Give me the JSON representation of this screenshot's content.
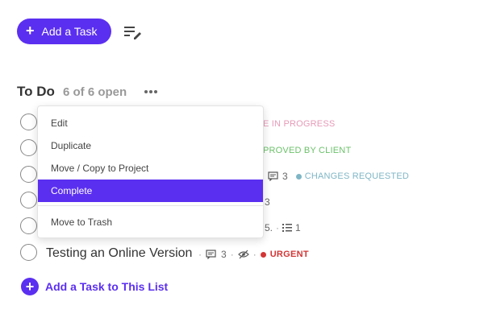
{
  "toolbar": {
    "add_task_label": "Add a Task"
  },
  "list": {
    "title": "To Do",
    "count": "6 of 6 open"
  },
  "menu": {
    "items": [
      "Edit",
      "Duplicate",
      "Move / Copy to Project",
      "Complete",
      "Move to Trash"
    ],
    "active": "Complete"
  },
  "rows": {
    "row1_status": "E IN PROGRESS",
    "row2_status": "PROVED BY CLIENT",
    "row3_comments": "3",
    "row3_status": "CHANGES REQUESTED",
    "row4_comments": "3",
    "row5_text": "5.",
    "row5_subtasks": "1",
    "row6_title": "Testing an Online Version",
    "row6_comments": "3",
    "row6_status": "URGENT"
  },
  "footer": {
    "add_task_list_label": "Add a Task to This List"
  },
  "colors": {
    "accent": "#5b2ff0",
    "in_progress": "#e69ab7",
    "approved": "#6cc16a",
    "changes_requested": "#7fb6c6",
    "urgent": "#d33636"
  },
  "icons": [
    "plus-icon",
    "edit-list-icon",
    "more-icon",
    "comment-icon",
    "subtask-icon",
    "hidden-eye-icon"
  ]
}
